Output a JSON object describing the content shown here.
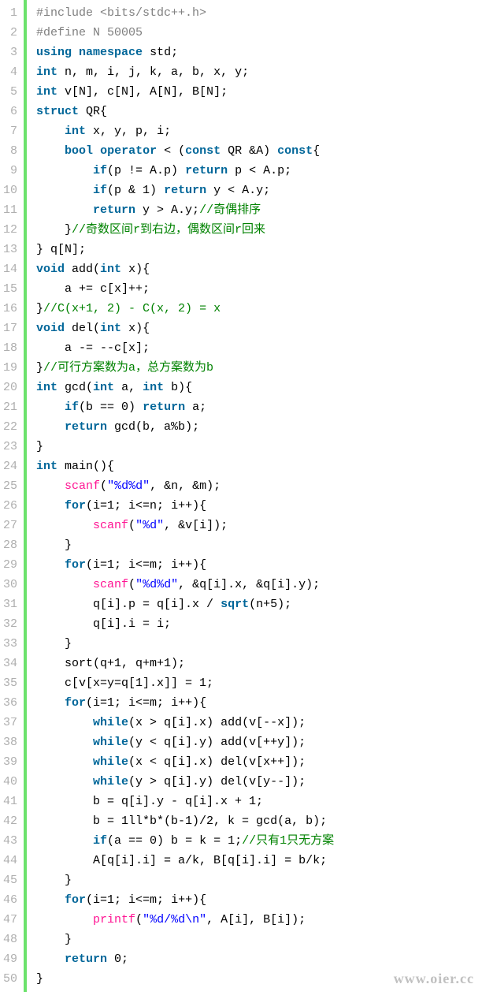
{
  "watermark": "www.oier.cc",
  "lineCount": 50,
  "lines": [
    [
      {
        "c": "pp",
        "t": "#include <bits/stdc++.h>"
      }
    ],
    [
      {
        "c": "pp",
        "t": "#define N 50005"
      }
    ],
    [
      {
        "c": "kw",
        "t": "using"
      },
      {
        "c": "id",
        "t": " "
      },
      {
        "c": "kw",
        "t": "namespace"
      },
      {
        "c": "id",
        "t": " std;"
      }
    ],
    [
      {
        "c": "ty",
        "t": "int"
      },
      {
        "c": "id",
        "t": " n, m, i, j, k, a, b, x, y;"
      }
    ],
    [
      {
        "c": "ty",
        "t": "int"
      },
      {
        "c": "id",
        "t": " v[N], c[N], A[N], B[N];"
      }
    ],
    [
      {
        "c": "kw",
        "t": "struct"
      },
      {
        "c": "id",
        "t": " QR{"
      }
    ],
    [
      {
        "c": "id",
        "t": "    "
      },
      {
        "c": "ty",
        "t": "int"
      },
      {
        "c": "id",
        "t": " x, y, p, i;"
      }
    ],
    [
      {
        "c": "id",
        "t": "    "
      },
      {
        "c": "ty",
        "t": "bool"
      },
      {
        "c": "id",
        "t": " "
      },
      {
        "c": "kw",
        "t": "operator"
      },
      {
        "c": "id",
        "t": " < ("
      },
      {
        "c": "kw",
        "t": "const"
      },
      {
        "c": "id",
        "t": " QR &A) "
      },
      {
        "c": "kw",
        "t": "const"
      },
      {
        "c": "id",
        "t": "{"
      }
    ],
    [
      {
        "c": "id",
        "t": "        "
      },
      {
        "c": "kw",
        "t": "if"
      },
      {
        "c": "id",
        "t": "(p != A.p) "
      },
      {
        "c": "kw",
        "t": "return"
      },
      {
        "c": "id",
        "t": " p < A.p;"
      }
    ],
    [
      {
        "c": "id",
        "t": "        "
      },
      {
        "c": "kw",
        "t": "if"
      },
      {
        "c": "id",
        "t": "(p & 1) "
      },
      {
        "c": "kw",
        "t": "return"
      },
      {
        "c": "id",
        "t": " y < A.y;"
      }
    ],
    [
      {
        "c": "id",
        "t": "        "
      },
      {
        "c": "kw",
        "t": "return"
      },
      {
        "c": "id",
        "t": " y > A.y;"
      },
      {
        "c": "cmt",
        "t": "//奇偶排序"
      }
    ],
    [
      {
        "c": "id",
        "t": "    }"
      },
      {
        "c": "cmt",
        "t": "//奇数区间r到右边，偶数区间r回来"
      }
    ],
    [
      {
        "c": "id",
        "t": "} q[N];"
      }
    ],
    [
      {
        "c": "ty",
        "t": "void"
      },
      {
        "c": "id",
        "t": " add("
      },
      {
        "c": "ty",
        "t": "int"
      },
      {
        "c": "id",
        "t": " x){"
      }
    ],
    [
      {
        "c": "id",
        "t": "    a += c[x]++;"
      }
    ],
    [
      {
        "c": "id",
        "t": "}"
      },
      {
        "c": "cmt",
        "t": "//C(x+1, 2) - C(x, 2) = x"
      }
    ],
    [
      {
        "c": "ty",
        "t": "void"
      },
      {
        "c": "id",
        "t": " del("
      },
      {
        "c": "ty",
        "t": "int"
      },
      {
        "c": "id",
        "t": " x){"
      }
    ],
    [
      {
        "c": "id",
        "t": "    a -= --c[x];"
      }
    ],
    [
      {
        "c": "id",
        "t": "}"
      },
      {
        "c": "cmt",
        "t": "//可行方案数为a，总方案数为b"
      }
    ],
    [
      {
        "c": "ty",
        "t": "int"
      },
      {
        "c": "id",
        "t": " gcd("
      },
      {
        "c": "ty",
        "t": "int"
      },
      {
        "c": "id",
        "t": " a, "
      },
      {
        "c": "ty",
        "t": "int"
      },
      {
        "c": "id",
        "t": " b){"
      }
    ],
    [
      {
        "c": "id",
        "t": "    "
      },
      {
        "c": "kw",
        "t": "if"
      },
      {
        "c": "id",
        "t": "(b == 0) "
      },
      {
        "c": "kw",
        "t": "return"
      },
      {
        "c": "id",
        "t": " a;"
      }
    ],
    [
      {
        "c": "id",
        "t": "    "
      },
      {
        "c": "kw",
        "t": "return"
      },
      {
        "c": "id",
        "t": " gcd(b, a%b);"
      }
    ],
    [
      {
        "c": "id",
        "t": "}"
      }
    ],
    [
      {
        "c": "ty",
        "t": "int"
      },
      {
        "c": "id",
        "t": " main(){"
      }
    ],
    [
      {
        "c": "id",
        "t": "    "
      },
      {
        "c": "fn",
        "t": "scanf"
      },
      {
        "c": "id",
        "t": "("
      },
      {
        "c": "str",
        "t": "\"%d%d\""
      },
      {
        "c": "id",
        "t": ", &n, &m);"
      }
    ],
    [
      {
        "c": "id",
        "t": "    "
      },
      {
        "c": "kw",
        "t": "for"
      },
      {
        "c": "id",
        "t": "(i=1; i<=n; i++){"
      }
    ],
    [
      {
        "c": "id",
        "t": "        "
      },
      {
        "c": "fn",
        "t": "scanf"
      },
      {
        "c": "id",
        "t": "("
      },
      {
        "c": "str",
        "t": "\"%d\""
      },
      {
        "c": "id",
        "t": ", &v[i]);"
      }
    ],
    [
      {
        "c": "id",
        "t": "    }"
      }
    ],
    [
      {
        "c": "id",
        "t": "    "
      },
      {
        "c": "kw",
        "t": "for"
      },
      {
        "c": "id",
        "t": "(i=1; i<=m; i++){"
      }
    ],
    [
      {
        "c": "id",
        "t": "        "
      },
      {
        "c": "fn",
        "t": "scanf"
      },
      {
        "c": "id",
        "t": "("
      },
      {
        "c": "str",
        "t": "\"%d%d\""
      },
      {
        "c": "id",
        "t": ", &q[i].x, &q[i].y);"
      }
    ],
    [
      {
        "c": "id",
        "t": "        q[i].p = q[i].x / "
      },
      {
        "c": "bfn",
        "t": "sqrt"
      },
      {
        "c": "id",
        "t": "(n+5);"
      }
    ],
    [
      {
        "c": "id",
        "t": "        q[i].i = i;"
      }
    ],
    [
      {
        "c": "id",
        "t": "    }"
      }
    ],
    [
      {
        "c": "id",
        "t": "    sort(q+1, q+m+1);"
      }
    ],
    [
      {
        "c": "id",
        "t": "    c[v[x=y=q[1].x]] = 1;"
      }
    ],
    [
      {
        "c": "id",
        "t": "    "
      },
      {
        "c": "kw",
        "t": "for"
      },
      {
        "c": "id",
        "t": "(i=1; i<=m; i++){"
      }
    ],
    [
      {
        "c": "id",
        "t": "        "
      },
      {
        "c": "kw",
        "t": "while"
      },
      {
        "c": "id",
        "t": "(x > q[i].x) add(v[--x]);"
      }
    ],
    [
      {
        "c": "id",
        "t": "        "
      },
      {
        "c": "kw",
        "t": "while"
      },
      {
        "c": "id",
        "t": "(y < q[i].y) add(v[++y]);"
      }
    ],
    [
      {
        "c": "id",
        "t": "        "
      },
      {
        "c": "kw",
        "t": "while"
      },
      {
        "c": "id",
        "t": "(x < q[i].x) del(v[x++]);"
      }
    ],
    [
      {
        "c": "id",
        "t": "        "
      },
      {
        "c": "kw",
        "t": "while"
      },
      {
        "c": "id",
        "t": "(y > q[i].y) del(v[y--]);"
      }
    ],
    [
      {
        "c": "id",
        "t": "        b = q[i].y - q[i].x + 1;"
      }
    ],
    [
      {
        "c": "id",
        "t": "        b = 1ll*b*(b-1)/2, k = gcd(a, b);"
      }
    ],
    [
      {
        "c": "id",
        "t": "        "
      },
      {
        "c": "kw",
        "t": "if"
      },
      {
        "c": "id",
        "t": "(a == 0) b = k = 1;"
      },
      {
        "c": "cmt",
        "t": "//只有1只无方案"
      }
    ],
    [
      {
        "c": "id",
        "t": "        A[q[i].i] = a/k, B[q[i].i] = b/k;"
      }
    ],
    [
      {
        "c": "id",
        "t": "    }"
      }
    ],
    [
      {
        "c": "id",
        "t": "    "
      },
      {
        "c": "kw",
        "t": "for"
      },
      {
        "c": "id",
        "t": "(i=1; i<=m; i++){"
      }
    ],
    [
      {
        "c": "id",
        "t": "        "
      },
      {
        "c": "fn",
        "t": "printf"
      },
      {
        "c": "id",
        "t": "("
      },
      {
        "c": "str",
        "t": "\"%d/%d\\n\""
      },
      {
        "c": "id",
        "t": ", A[i], B[i]);"
      }
    ],
    [
      {
        "c": "id",
        "t": "    }"
      }
    ],
    [
      {
        "c": "id",
        "t": "    "
      },
      {
        "c": "kw",
        "t": "return"
      },
      {
        "c": "id",
        "t": " 0;"
      }
    ],
    [
      {
        "c": "id",
        "t": "}"
      }
    ]
  ]
}
